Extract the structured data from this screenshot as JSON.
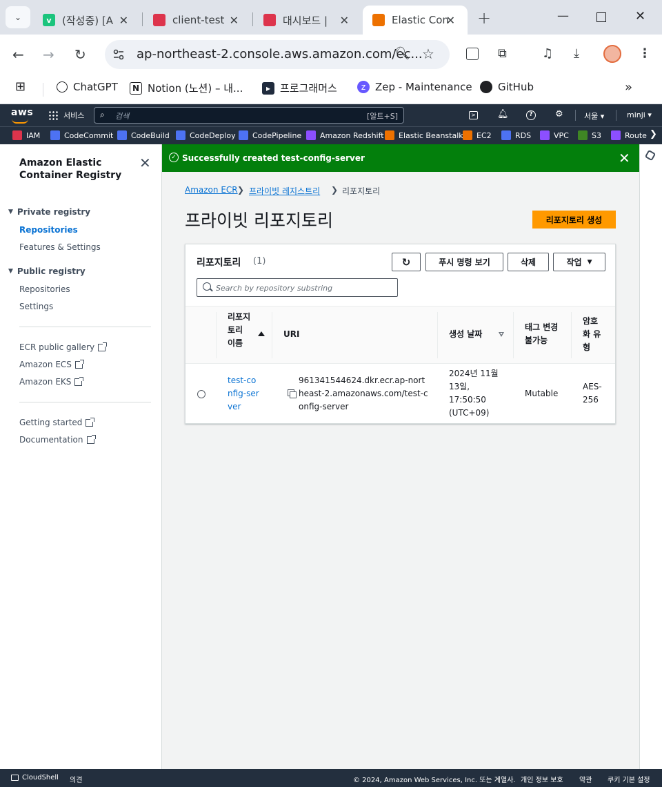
{
  "browser": {
    "tabs": [
      {
        "title": "(작성중) [A",
        "favicon_color": "#1bc47d",
        "favicon_letter": "v",
        "active": false
      },
      {
        "title": "client-test",
        "favicon_color": "#dd344c",
        "favicon_letter": "",
        "active": false
      },
      {
        "title": "대시보드 |",
        "favicon_color": "#dd344c",
        "favicon_letter": "",
        "active": false
      },
      {
        "title": "Elastic Con",
        "favicon_color": "#ed7100",
        "favicon_letter": "",
        "active": true
      }
    ],
    "url": "ap-northeast-2.console.aws.amazon.com/ec...",
    "bookmarks": [
      {
        "label": "ChatGPT",
        "icon": "chatgpt-icon"
      },
      {
        "label": "Notion (노션) – 내...",
        "icon": "notion-icon"
      },
      {
        "label": "프로그래머스",
        "icon": "programmers-icon"
      },
      {
        "label": "Zep - Maintenance",
        "icon": "zep-icon"
      },
      {
        "label": "GitHub",
        "icon": "github-icon"
      }
    ]
  },
  "aws_nav": {
    "logo": "aws",
    "services": "서비스",
    "search_placeholder": "검색",
    "search_shortcut": "[알트+S]",
    "region": "서울 ▾",
    "user": "minji ▾",
    "favorites": [
      {
        "label": "IAM",
        "color": "#dd344c"
      },
      {
        "label": "CodeCommit",
        "color": "#4d72f3"
      },
      {
        "label": "CodeBuild",
        "color": "#4d72f3"
      },
      {
        "label": "CodeDeploy",
        "color": "#4d72f3"
      },
      {
        "label": "CodePipeline",
        "color": "#4d72f3"
      },
      {
        "label": "Amazon Redshift",
        "color": "#8c4fff"
      },
      {
        "label": "Elastic Beanstalk",
        "color": "#ed7100"
      },
      {
        "label": "EC2",
        "color": "#ed7100"
      },
      {
        "label": "RDS",
        "color": "#4d72f3"
      },
      {
        "label": "VPC",
        "color": "#8c4fff"
      },
      {
        "label": "S3",
        "color": "#3f8624"
      },
      {
        "label": "Route",
        "color": "#8c4fff"
      }
    ]
  },
  "sidebar": {
    "title": "Amazon Elastic Container Registry",
    "private_section": "Private registry",
    "private_items": [
      "Repositories",
      "Features & Settings"
    ],
    "public_section": "Public registry",
    "public_items": [
      "Repositories",
      "Settings"
    ],
    "external_links": [
      "ECR public gallery",
      "Amazon ECS",
      "Amazon EKS"
    ],
    "help_links": [
      "Getting started",
      "Documentation"
    ]
  },
  "flash": {
    "message": "Successfully created test-config-server"
  },
  "breadcrumb": [
    "Amazon ECR",
    "프라이빗 레지스트리",
    "리포지토리"
  ],
  "page": {
    "title": "프라이빗 리포지토리",
    "create_button": "리포지토리 생성"
  },
  "panel": {
    "title": "리포지토리",
    "count": "(1)",
    "buttons": {
      "view_push": "푸시 명령 보기",
      "delete": "삭제",
      "actions": "작업"
    },
    "search_placeholder": "Search by repository substring",
    "columns": {
      "name": "리포지토리 이름",
      "uri": "URI",
      "created": "생성 날짜",
      "immutability": "태그 변경 불가능",
      "encryption": "암호화 유형"
    },
    "rows": [
      {
        "name": "test-config-server",
        "uri": "961341544624.dkr.ecr.ap-northeast-2.amazonaws.com/test-config-server",
        "created": "2024년 11월 13일, 17:50:50 (UTC+09)",
        "immutability": "Mutable",
        "encryption": "AES-256"
      }
    ]
  },
  "footer": {
    "cloudshell": "CloudShell",
    "feedback": "의견",
    "copyright": "© 2024, Amazon Web Services, Inc. 또는 계열사.",
    "privacy": "개인 정보 보호",
    "terms": "약관",
    "cookies": "쿠키 기본 설정"
  }
}
